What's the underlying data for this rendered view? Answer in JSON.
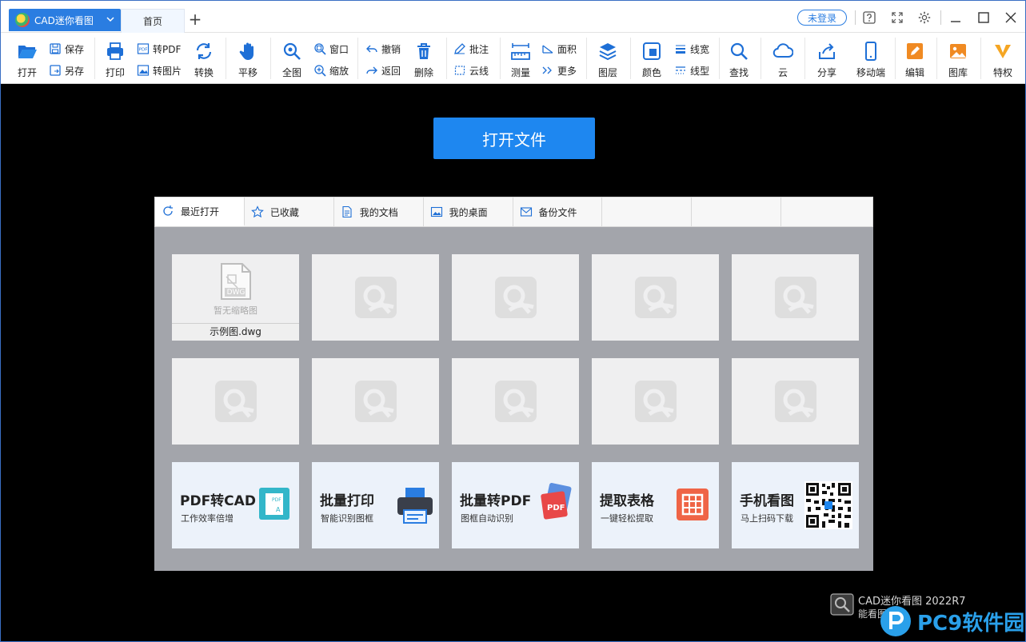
{
  "titlebar": {
    "app_name": "CAD迷你看图",
    "home_tab": "首页",
    "add_tab": "+",
    "login": "未登录"
  },
  "ribbon": {
    "open": "打开",
    "save": "保存",
    "save_as": "另存",
    "print": "打印",
    "to_pdf": "转PDF",
    "to_image": "转图片",
    "convert": "转换",
    "pan": "平移",
    "fit_all": "全图",
    "window": "窗口",
    "zoom": "缩放",
    "undo": "撤销",
    "back": "返回",
    "delete": "删除",
    "annotate": "批注",
    "cloud_line": "云线",
    "measure": "测量",
    "area": "面积",
    "more": "更多",
    "layers": "图层",
    "color": "颜色",
    "line_width": "线宽",
    "line_type": "线型",
    "find": "查找",
    "cloud": "云",
    "share": "分享",
    "mobile": "移动端",
    "edit": "编辑",
    "library": "图库",
    "vip": "特权"
  },
  "main": {
    "open_file_button": "打开文件",
    "tabs": [
      {
        "label": "最近打开"
      },
      {
        "label": "已收藏"
      },
      {
        "label": "我的文档"
      },
      {
        "label": "我的桌面"
      },
      {
        "label": "备份文件"
      },
      {
        "label": ""
      },
      {
        "label": ""
      },
      {
        "label": ""
      }
    ],
    "first_file": {
      "badge": "DWG",
      "no_thumb": "暂无缩略图",
      "name": "示例图.dwg"
    },
    "promos": [
      {
        "title": "PDF转CAD",
        "subtitle": "工作效率倍增"
      },
      {
        "title": "批量打印",
        "subtitle": "智能识别图框"
      },
      {
        "title": "批量转PDF",
        "subtitle": "图框自动识别"
      },
      {
        "title": "提取表格",
        "subtitle": "一键轻松提取"
      },
      {
        "title": "手机看图",
        "subtitle": "马上扫码下载"
      }
    ]
  },
  "footer": {
    "brand": "CAD迷你看图  2022R7",
    "brand_sub": "能看图",
    "watermark": "PC9软件园"
  },
  "colors": {
    "accent": "#1e87f0",
    "panel_bg": "#a3a5ab",
    "tile_bg": "#efeff0"
  }
}
